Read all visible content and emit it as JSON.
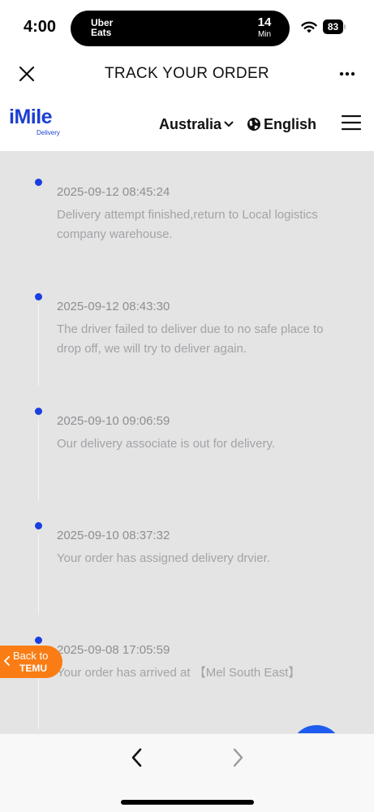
{
  "status_bar": {
    "time": "4:00",
    "live_activity": {
      "app": "Uber Eats",
      "minutes": "14",
      "unit": "Min"
    },
    "battery": "83"
  },
  "nav": {
    "title": "TRACK YOUR ORDER",
    "close_icon": "close-icon",
    "more_icon": "more-icon"
  },
  "site": {
    "logo_text": "iMile",
    "logo_sub": "Delivery",
    "country": "Australia",
    "language": "English"
  },
  "events": [
    {
      "time": "2025-09-12 08:45:24",
      "desc": "Delivery attempt finished,return to Local logistics company warehouse."
    },
    {
      "time": "2025-09-12 08:43:30",
      "desc": "The driver failed to deliver due to no safe place to drop off, we will try to deliver again."
    },
    {
      "time": "2025-09-10 09:06:59",
      "desc": "Our delivery associate is out for delivery."
    },
    {
      "time": "2025-09-10 08:37:32",
      "desc": "Your order has assigned delivery drvier."
    },
    {
      "time": "2025-09-08 17:05:59",
      "desc": "Your order has arrived at 【Mel South East】"
    }
  ],
  "back_temu": {
    "line1": "Back to",
    "line2": "TEMU"
  },
  "colors": {
    "brand": "#1c3fd1",
    "dot": "#1a3ee0",
    "temu_orange": "#f97d14",
    "timeline_bg": "#e4e4e4"
  }
}
